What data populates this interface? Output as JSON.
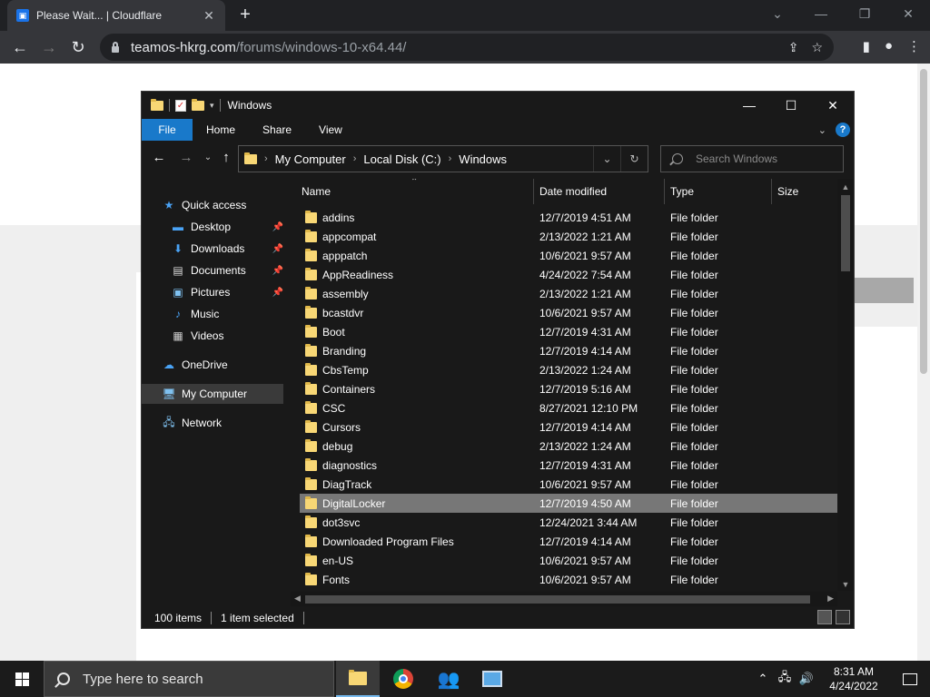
{
  "browser": {
    "tab_title": "Please Wait... | Cloudflare",
    "url_host": "teamos-hkrg.com",
    "url_path": "/forums/windows-10-x64.44/"
  },
  "explorer": {
    "window_title": "Windows",
    "ribbon": {
      "file": "File",
      "tabs": [
        "Home",
        "Share",
        "View"
      ]
    },
    "breadcrumb": [
      "My Computer",
      "Local Disk (C:)",
      "Windows"
    ],
    "search_placeholder": "Search Windows",
    "nav": [
      {
        "label": "Quick access",
        "icon": "star-icon",
        "pinned": false
      },
      {
        "label": "Desktop",
        "icon": "desktop-icon",
        "pinned": true
      },
      {
        "label": "Downloads",
        "icon": "download-icon",
        "pinned": true
      },
      {
        "label": "Documents",
        "icon": "document-icon",
        "pinned": true
      },
      {
        "label": "Pictures",
        "icon": "picture-icon",
        "pinned": true
      },
      {
        "label": "Music",
        "icon": "music-icon",
        "pinned": false
      },
      {
        "label": "Videos",
        "icon": "video-icon",
        "pinned": false
      },
      {
        "label": "OneDrive",
        "icon": "cloud-icon",
        "pinned": false
      },
      {
        "label": "My Computer",
        "icon": "computer-icon",
        "pinned": false,
        "selected": true
      },
      {
        "label": "Network",
        "icon": "network-icon",
        "pinned": false
      }
    ],
    "columns": [
      "Name",
      "Date modified",
      "Type",
      "Size"
    ],
    "files": [
      {
        "name": "addins",
        "date": "12/7/2019 4:51 AM",
        "type": "File folder"
      },
      {
        "name": "appcompat",
        "date": "2/13/2022 1:21 AM",
        "type": "File folder"
      },
      {
        "name": "apppatch",
        "date": "10/6/2021 9:57 AM",
        "type": "File folder"
      },
      {
        "name": "AppReadiness",
        "date": "4/24/2022 7:54 AM",
        "type": "File folder"
      },
      {
        "name": "assembly",
        "date": "2/13/2022 1:21 AM",
        "type": "File folder"
      },
      {
        "name": "bcastdvr",
        "date": "10/6/2021 9:57 AM",
        "type": "File folder"
      },
      {
        "name": "Boot",
        "date": "12/7/2019 4:31 AM",
        "type": "File folder"
      },
      {
        "name": "Branding",
        "date": "12/7/2019 4:14 AM",
        "type": "File folder"
      },
      {
        "name": "CbsTemp",
        "date": "2/13/2022 1:24 AM",
        "type": "File folder"
      },
      {
        "name": "Containers",
        "date": "12/7/2019 5:16 AM",
        "type": "File folder"
      },
      {
        "name": "CSC",
        "date": "8/27/2021 12:10 PM",
        "type": "File folder"
      },
      {
        "name": "Cursors",
        "date": "12/7/2019 4:14 AM",
        "type": "File folder"
      },
      {
        "name": "debug",
        "date": "2/13/2022 1:24 AM",
        "type": "File folder"
      },
      {
        "name": "diagnostics",
        "date": "12/7/2019 4:31 AM",
        "type": "File folder"
      },
      {
        "name": "DiagTrack",
        "date": "10/6/2021 9:57 AM",
        "type": "File folder"
      },
      {
        "name": "DigitalLocker",
        "date": "12/7/2019 4:50 AM",
        "type": "File folder",
        "selected": true
      },
      {
        "name": "dot3svc",
        "date": "12/24/2021 3:44 AM",
        "type": "File folder"
      },
      {
        "name": "Downloaded Program Files",
        "date": "12/7/2019 4:14 AM",
        "type": "File folder"
      },
      {
        "name": "en-US",
        "date": "10/6/2021 9:57 AM",
        "type": "File folder"
      },
      {
        "name": "Fonts",
        "date": "10/6/2021 9:57 AM",
        "type": "File folder",
        "icon": "fonts-folder-icon"
      }
    ],
    "status": {
      "items": "100 items",
      "selected": "1 item selected"
    }
  },
  "taskbar": {
    "search_placeholder": "Type here to search",
    "time": "8:31 AM",
    "date": "4/24/2022"
  },
  "colors": {
    "accent": "#1979ca",
    "folder": "#f8d775",
    "selection": "#777777"
  }
}
